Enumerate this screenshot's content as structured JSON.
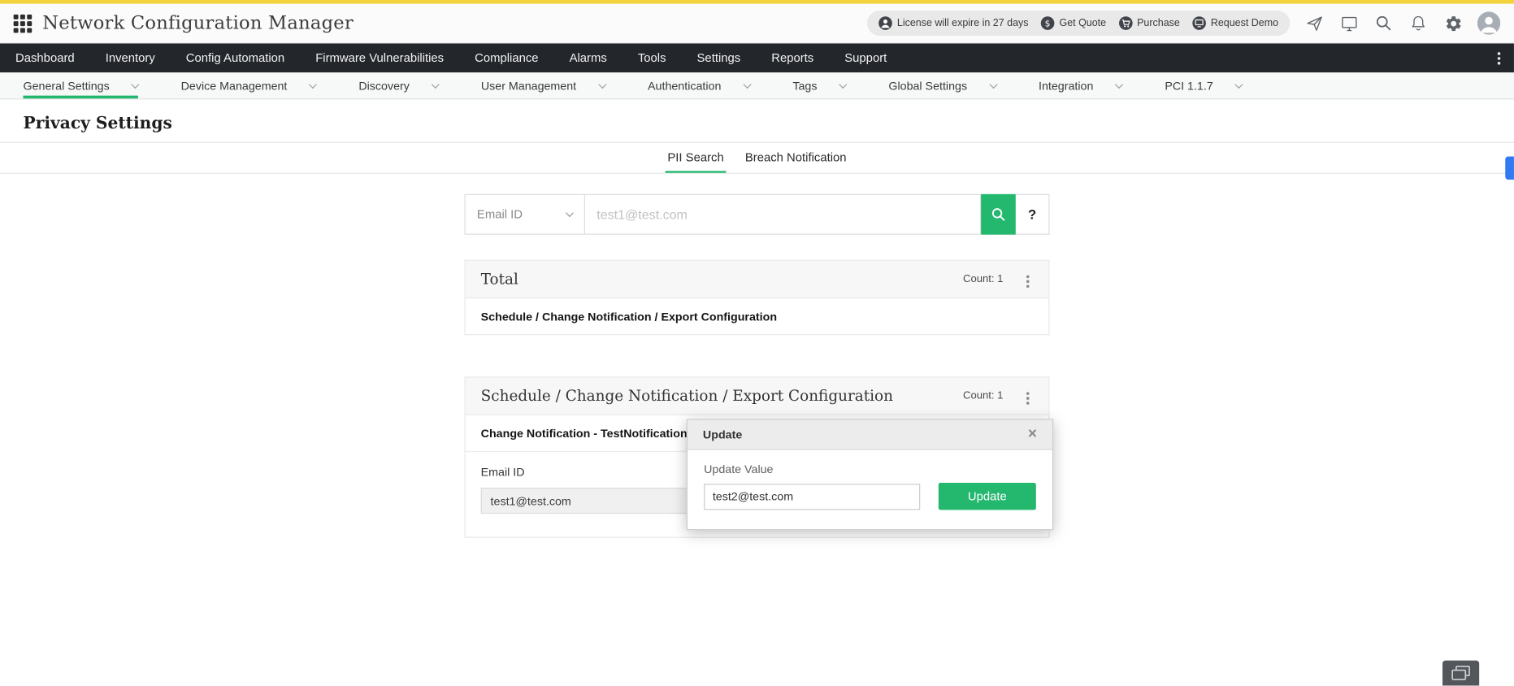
{
  "app": {
    "title": "Network Configuration Manager",
    "pills": [
      {
        "label": "License will expire in 27 days",
        "icon": "user-circle"
      },
      {
        "label": "Get Quote",
        "icon": "dollar-circle"
      },
      {
        "label": "Purchase",
        "icon": "cart-circle"
      },
      {
        "label": "Request Demo",
        "icon": "monitor-circle"
      }
    ]
  },
  "main_nav": {
    "items": [
      "Dashboard",
      "Inventory",
      "Config Automation",
      "Firmware Vulnerabilities",
      "Compliance",
      "Alarms",
      "Tools",
      "Settings",
      "Reports",
      "Support"
    ]
  },
  "sub_nav": {
    "items": [
      {
        "label": "General Settings",
        "active": true
      },
      {
        "label": "Device Management",
        "active": false
      },
      {
        "label": "Discovery",
        "active": false
      },
      {
        "label": "User Management",
        "active": false
      },
      {
        "label": "Authentication",
        "active": false
      },
      {
        "label": "Tags",
        "active": false
      },
      {
        "label": "Global Settings",
        "active": false
      },
      {
        "label": "Integration",
        "active": false
      },
      {
        "label": "PCI 1.1.7",
        "active": false
      }
    ]
  },
  "page": {
    "title": "Privacy Settings",
    "tabs": [
      {
        "label": "PII Search",
        "active": true
      },
      {
        "label": "Breach Notification",
        "active": false
      }
    ],
    "search": {
      "filter_selected": "Email ID",
      "query_placeholder": "test1@test.com",
      "help_label": "?"
    },
    "total_card": {
      "title": "Total",
      "count_label": "Count: 1",
      "rows": [
        "Schedule / Change Notification / Export Configuration"
      ]
    },
    "result_card": {
      "title": "Schedule / Change Notification / Export Configuration",
      "count_label": "Count: 1",
      "rows": [
        "Change Notification - TestNotification - E"
      ],
      "field_label": "Email ID",
      "field_value": "test1@test.com"
    },
    "update_popup": {
      "title": "Update",
      "field_label": "Update Value",
      "field_value": "test2@test.com",
      "submit_label": "Update"
    }
  },
  "colors": {
    "accent_green": "#24b76e",
    "brand_yellow": "#f2d23d",
    "nav_dark": "#23262b",
    "scroll_blue": "#3279f6"
  }
}
